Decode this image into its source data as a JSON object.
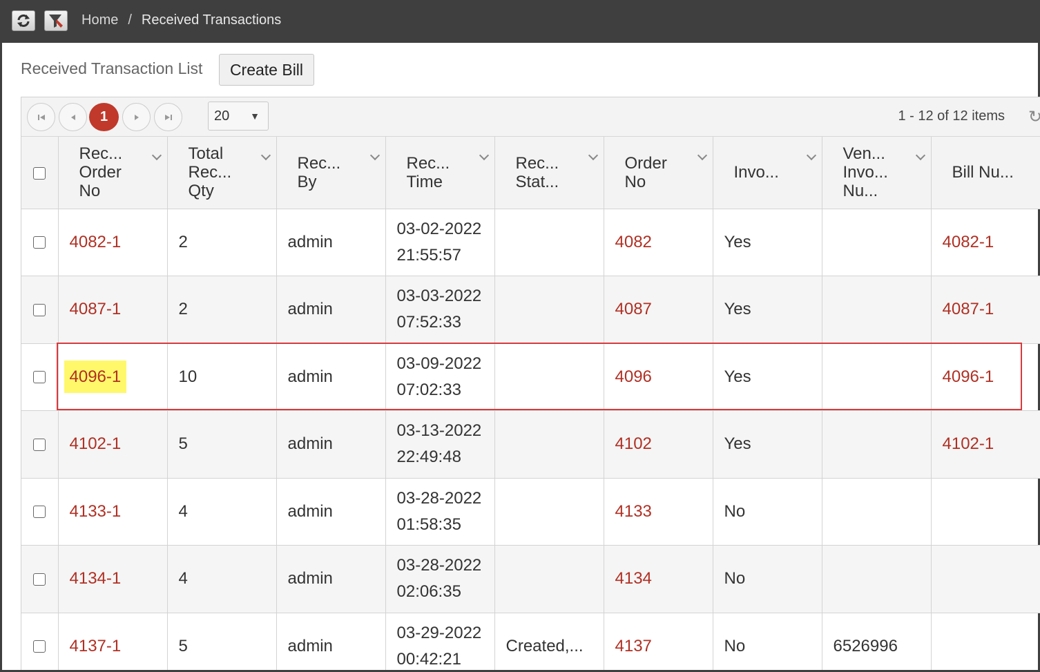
{
  "toolbar": {
    "refresh_icon": "refresh-icon",
    "filter_icon": "filter-icon"
  },
  "breadcrumb": {
    "home": "Home",
    "separator": "/",
    "current": "Received Transactions"
  },
  "page": {
    "list_title": "Received Transaction List",
    "create_bill_label": "Create Bill"
  },
  "pager": {
    "current_page": "1",
    "page_size": "20",
    "info": "1 - 12 of 12 items"
  },
  "columns": [
    {
      "label": "Rec... Order No"
    },
    {
      "label": "Total Rec... Qty"
    },
    {
      "label": "Rec... By"
    },
    {
      "label": "Rec... Time"
    },
    {
      "label": "Rec... Stat..."
    },
    {
      "label": "Order No"
    },
    {
      "label": "Invo..."
    },
    {
      "label": "Ven... Invo... Nu..."
    },
    {
      "label": "Bill Nu..."
    }
  ],
  "rows": [
    {
      "rec_order_no": "4082-1",
      "qty": "2",
      "by": "admin",
      "date": "03-02-2022",
      "time": "21:55:57",
      "status": "",
      "order_no": "4082",
      "invoiced": "Yes",
      "vendor_invoice": "",
      "bill_no": "4082-1"
    },
    {
      "rec_order_no": "4087-1",
      "qty": "2",
      "by": "admin",
      "date": "03-03-2022",
      "time": "07:52:33",
      "status": "",
      "order_no": "4087",
      "invoiced": "Yes",
      "vendor_invoice": "",
      "bill_no": "4087-1"
    },
    {
      "rec_order_no": "4096-1",
      "qty": "10",
      "by": "admin",
      "date": "03-09-2022",
      "time": "07:02:33",
      "status": "",
      "order_no": "4096",
      "invoiced": "Yes",
      "vendor_invoice": "",
      "bill_no": "4096-1"
    },
    {
      "rec_order_no": "4102-1",
      "qty": "5",
      "by": "admin",
      "date": "03-13-2022",
      "time": "22:49:48",
      "status": "",
      "order_no": "4102",
      "invoiced": "Yes",
      "vendor_invoice": "",
      "bill_no": "4102-1"
    },
    {
      "rec_order_no": "4133-1",
      "qty": "4",
      "by": "admin",
      "date": "03-28-2022",
      "time": "01:58:35",
      "status": "",
      "order_no": "4133",
      "invoiced": "No",
      "vendor_invoice": "",
      "bill_no": ""
    },
    {
      "rec_order_no": "4134-1",
      "qty": "4",
      "by": "admin",
      "date": "03-28-2022",
      "time": "02:06:35",
      "status": "",
      "order_no": "4134",
      "invoiced": "No",
      "vendor_invoice": "",
      "bill_no": ""
    },
    {
      "rec_order_no": "4137-1",
      "qty": "5",
      "by": "admin",
      "date": "03-29-2022",
      "time": "00:42:21",
      "status": "Created,...",
      "order_no": "4137",
      "invoiced": "No",
      "vendor_invoice": "6526996",
      "bill_no": ""
    }
  ]
}
